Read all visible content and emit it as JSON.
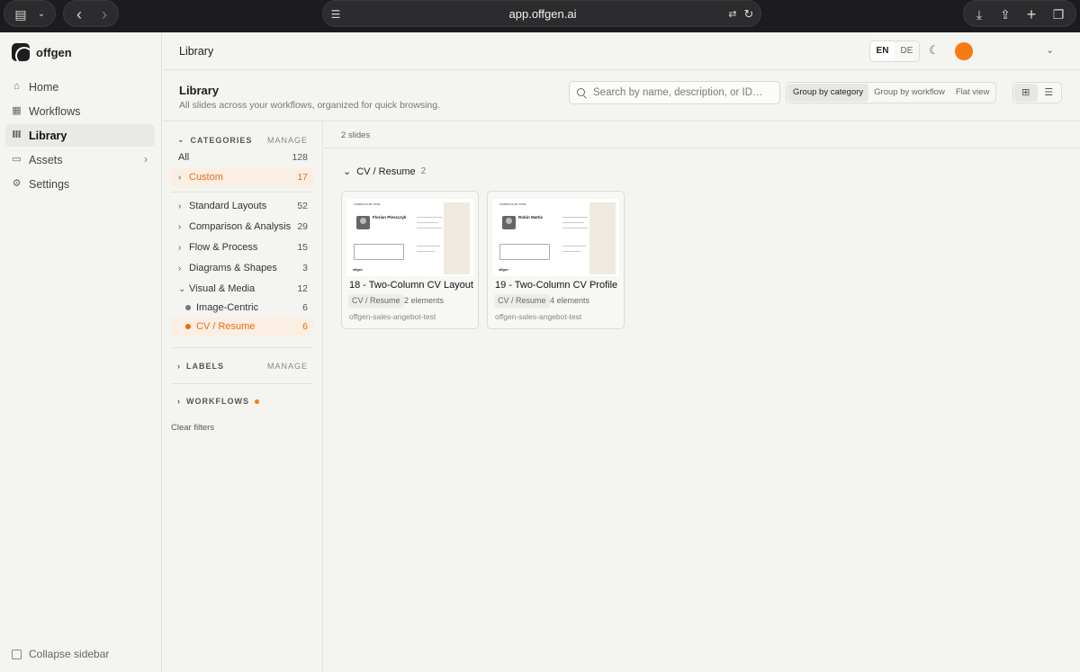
{
  "browser": {
    "url": "app.offgen.ai"
  },
  "sidebar": {
    "brand": "offgen",
    "items": [
      {
        "label": "Home",
        "icon": "home-icon"
      },
      {
        "label": "Workflows",
        "icon": "grid-icon"
      },
      {
        "label": "Library",
        "icon": "library-icon"
      },
      {
        "label": "Assets",
        "icon": "folder-icon"
      },
      {
        "label": "Settings",
        "icon": "gear-icon"
      }
    ],
    "collapse_label": "Collapse sidebar"
  },
  "topbar": {
    "title": "Library",
    "lang": [
      "EN",
      "DE"
    ],
    "active_lang": "EN",
    "avatar_color": "#f57c14"
  },
  "page": {
    "title": "Library",
    "subtitle": "All slides across your workflows, organized for quick browsing.",
    "search_placeholder": "Search by name, description, or ID…",
    "grouping": [
      "Group by category",
      "Group by workflow",
      "Flat view"
    ],
    "active_grouping": "Group by category"
  },
  "filters": {
    "categories_title": "CATEGORIES",
    "manage": "MANAGE",
    "all": {
      "label": "All",
      "count": "128"
    },
    "custom": {
      "label": "Custom",
      "count": "17"
    },
    "list": [
      {
        "label": "Standard Layouts",
        "count": "52"
      },
      {
        "label": "Comparison & Analysis",
        "count": "29"
      },
      {
        "label": "Flow & Process",
        "count": "15"
      },
      {
        "label": "Diagrams & Shapes",
        "count": "3"
      },
      {
        "label": "Visual & Media",
        "count": "12"
      }
    ],
    "sub": [
      {
        "label": "Image-Centric",
        "count": "6"
      },
      {
        "label": "CV / Resume",
        "count": "6"
      }
    ],
    "labels_title": "LABELS",
    "workflows_title": "WORKFLOWS",
    "clear": "Clear filters",
    "accent": "#e86c12"
  },
  "main": {
    "count_text": "2 slides",
    "group_label": "CV / Resume",
    "group_count": "2",
    "cards": [
      {
        "title": "18 - Two-Column CV Layout",
        "tag": "CV / Resume",
        "elements": "2 elements",
        "workflow": "offgen-sales-angebot-test",
        "person": "Florian Pleszczyk"
      },
      {
        "title": "19 - Two-Column CV Profile",
        "tag": "CV / Resume",
        "elements": "4 elements",
        "workflow": "offgen-sales-angebot-test",
        "person": "Robin Mattis"
      }
    ]
  }
}
